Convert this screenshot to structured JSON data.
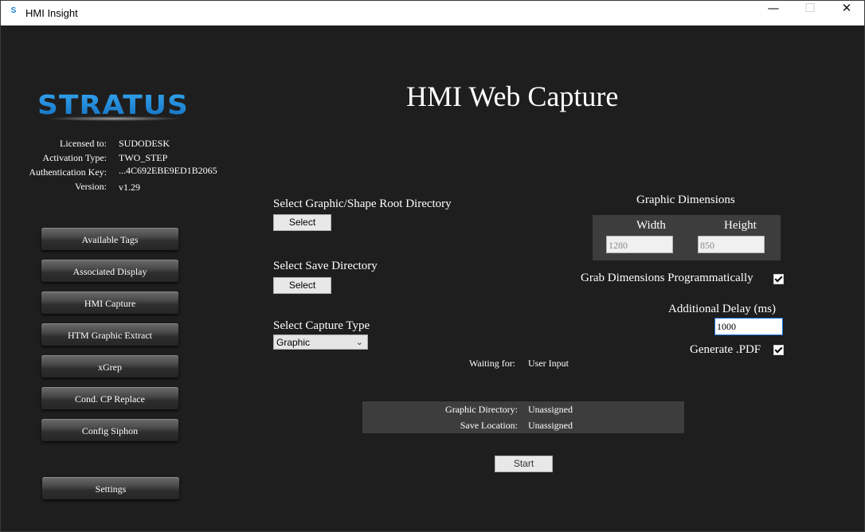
{
  "window": {
    "title": "HMI Insight",
    "app_icon": "S",
    "minimize_glyph": "—",
    "maximize_glyph": "☐",
    "close_glyph": "✕"
  },
  "logo": {
    "text": "STRATUS",
    "color": "#1e90e0"
  },
  "license": {
    "licensed_to_label": "Licensed to:",
    "licensed_to": "SUDODESK",
    "activation_type_label": "Activation Type:",
    "activation_type": "TWO_STEP",
    "auth_key_label": "Authentication Key:",
    "auth_key": "...4C692EBE9ED1B2065",
    "version_label": "Version:",
    "version": "v1.29"
  },
  "sidebar": {
    "items": [
      {
        "label": "Available Tags"
      },
      {
        "label": "Associated Display"
      },
      {
        "label": "HMI Capture"
      },
      {
        "label": "HTM Graphic Extract"
      },
      {
        "label": "xGrep"
      },
      {
        "label": "Cond. CP Replace"
      },
      {
        "label": "Config Siphon"
      }
    ],
    "settings_label": "Settings"
  },
  "main": {
    "heading": "HMI Web Capture",
    "graphic_root_label": "Select Graphic/Shape Root Directory",
    "graphic_root_button": "Select",
    "save_dir_label": "Select Save Directory",
    "save_dir_button": "Select",
    "capture_type_label": "Select Capture Type",
    "capture_type_value": "Graphic",
    "waiting_label": "Waiting for:",
    "waiting_value": "User Input",
    "dimensions": {
      "title": "Graphic Dimensions",
      "width_label": "Width",
      "height_label": "Height",
      "width_value": "1280",
      "height_value": "850"
    },
    "grab_dims_label": "Grab Dimensions Programmatically",
    "grab_dims_checked": true,
    "delay_label": "Additional Delay (ms)",
    "delay_value": "1000",
    "generate_pdf_label": "Generate .PDF",
    "generate_pdf_checked": true,
    "status": {
      "graphic_dir_label": "Graphic Directory:",
      "graphic_dir_value": "Unassigned",
      "save_location_label": "Save Location:",
      "save_location_value": "Unassigned"
    },
    "start_button": "Start"
  }
}
